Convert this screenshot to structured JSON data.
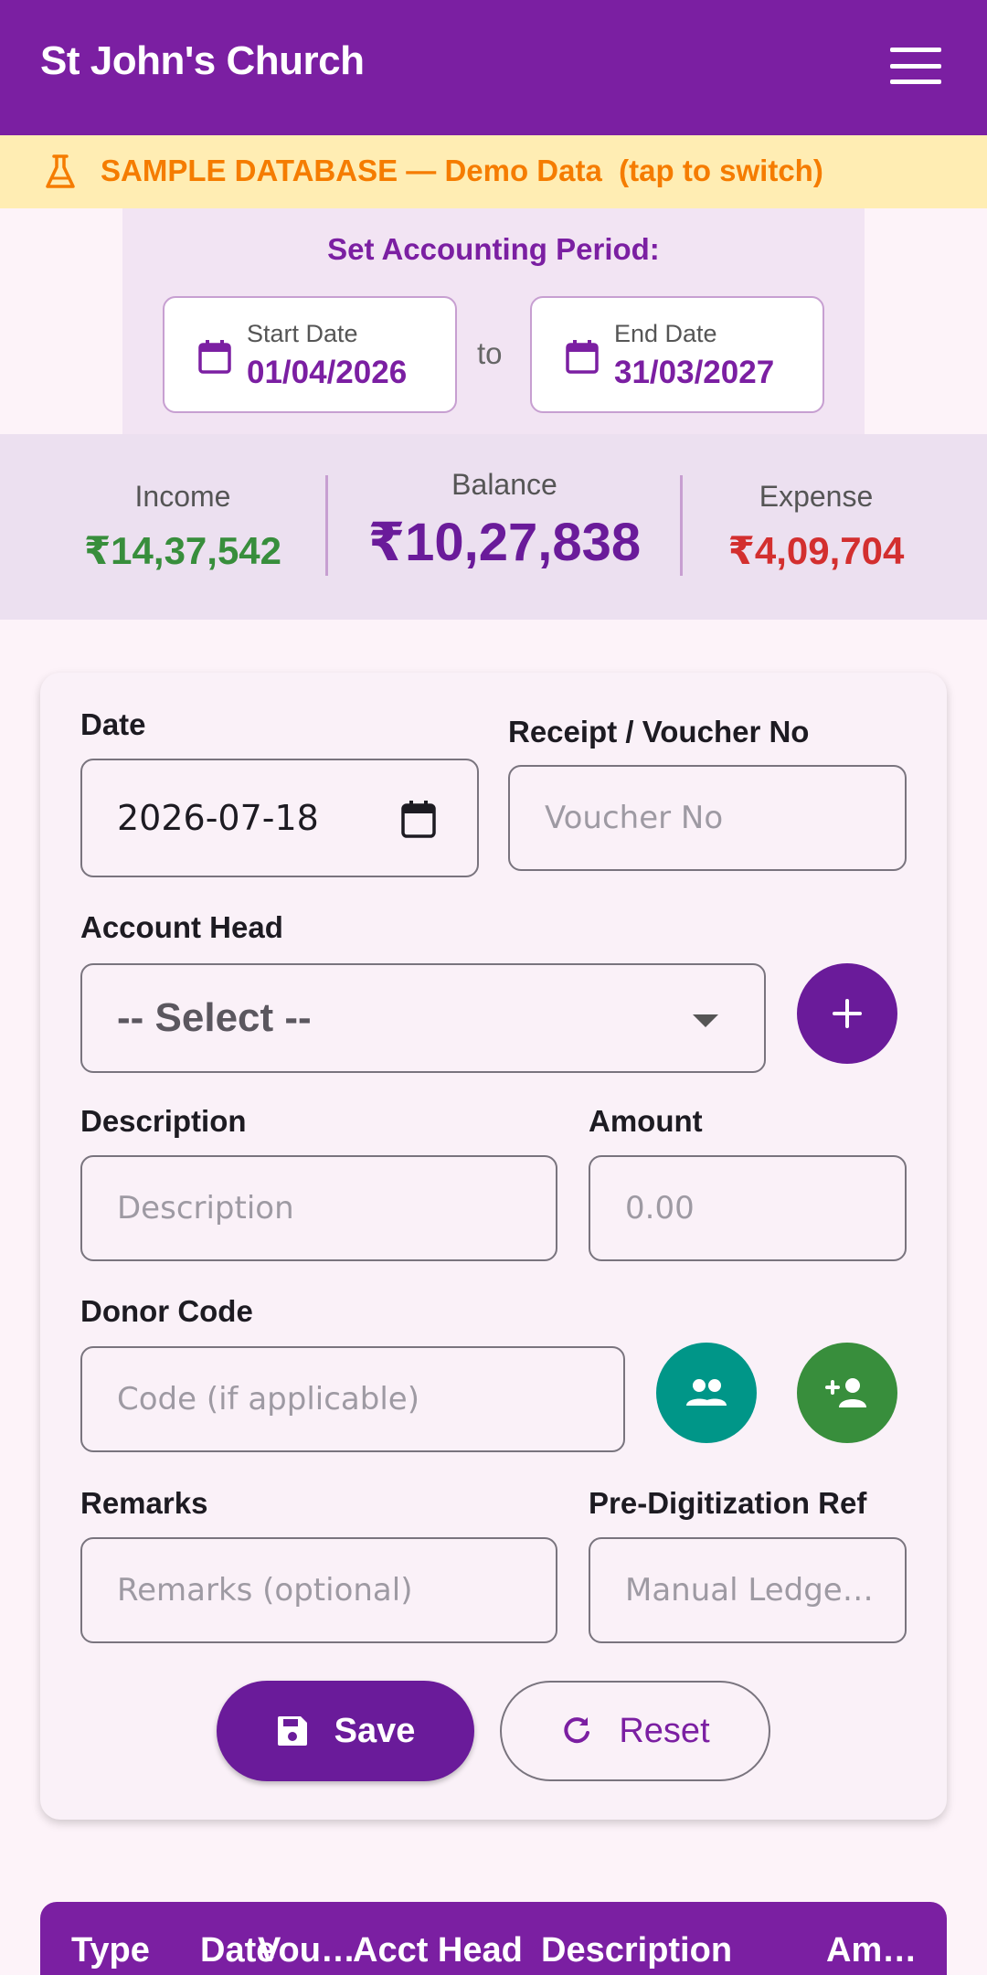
{
  "app": {
    "title": "St John's Church"
  },
  "banner": {
    "text": "SAMPLE DATABASE — Demo Data  (tap to switch)",
    "color": "#f57c00"
  },
  "period": {
    "label": "Set Accounting Period:",
    "start_label": "Start Date",
    "start_value": "01/04/2026",
    "separator": "to",
    "end_label": "End Date",
    "end_value": "31/03/2027"
  },
  "summary": {
    "income_label": "Income",
    "income_value": "₹14,37,542",
    "balance_label": "Balance",
    "balance_value": "₹10,27,838",
    "expense_label": "Expense",
    "expense_value": "₹4,09,704",
    "colors": {
      "income": "#388e3c",
      "balance": "#6a1b9a",
      "expense": "#d32f2f"
    }
  },
  "form": {
    "date_label": "Date",
    "date_value": "2026-07-18",
    "voucher_label": "Receipt / Voucher No",
    "voucher_placeholder": "Voucher No",
    "account_label": "Account Head",
    "account_selected": "-- Select --",
    "description_label": "Description",
    "description_placeholder": "Description",
    "amount_label": "Amount",
    "amount_placeholder": "0.00",
    "donor_label": "Donor Code",
    "donor_placeholder": "Code (if applicable)",
    "remarks_label": "Remarks",
    "remarks_placeholder": "Remarks (optional)",
    "preref_label": "Pre-Digitization Ref",
    "preref_placeholder": "Manual Ledge…",
    "save_label": "Save",
    "reset_label": "Reset"
  },
  "icons": {
    "menu": "menu-icon",
    "flask": "flask-icon",
    "calendar": "calendar-icon",
    "add": "plus-icon",
    "donors": "people-icon",
    "add_donor": "person-add-icon",
    "save": "floppy-icon",
    "reset": "refresh-icon"
  },
  "table": {
    "columns": [
      "Type",
      "Date",
      "Vou…",
      "Acct Head",
      "Description",
      "Am…"
    ]
  },
  "colors": {
    "primary": "#7b1fa2",
    "teal": "#009688",
    "green": "#388e3c"
  }
}
